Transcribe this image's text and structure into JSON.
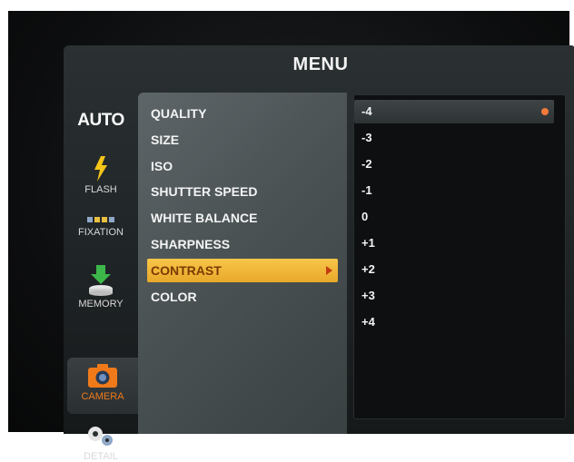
{
  "menu": {
    "title": "MENU"
  },
  "rail": {
    "auto": "AUTO",
    "items": [
      {
        "label": "FLASH",
        "icon": "lightning-icon"
      },
      {
        "label": "FIXATION",
        "icon": "fixation-icon"
      },
      {
        "label": "MEMORY",
        "icon": "memory-download-icon"
      },
      {
        "label": "CAMERA",
        "icon": "camera-icon",
        "selected": true
      },
      {
        "label": "DETAIL",
        "icon": "gears-icon"
      }
    ]
  },
  "settings": {
    "items": [
      "QUALITY",
      "SIZE",
      "ISO",
      "SHUTTER SPEED",
      "WHITE BALANCE",
      "SHARPNESS",
      "CONTRAST",
      "COLOR"
    ],
    "selected": "CONTRAST"
  },
  "values": {
    "items": [
      "-4",
      "-3",
      "-2",
      "-1",
      "0",
      "+1",
      "+2",
      "+3",
      "+4"
    ],
    "highlighted": "-4"
  },
  "colors": {
    "selection": "#f0b53a",
    "camera_accent": "#f07a1a",
    "value_marker": "#f07a3a"
  }
}
